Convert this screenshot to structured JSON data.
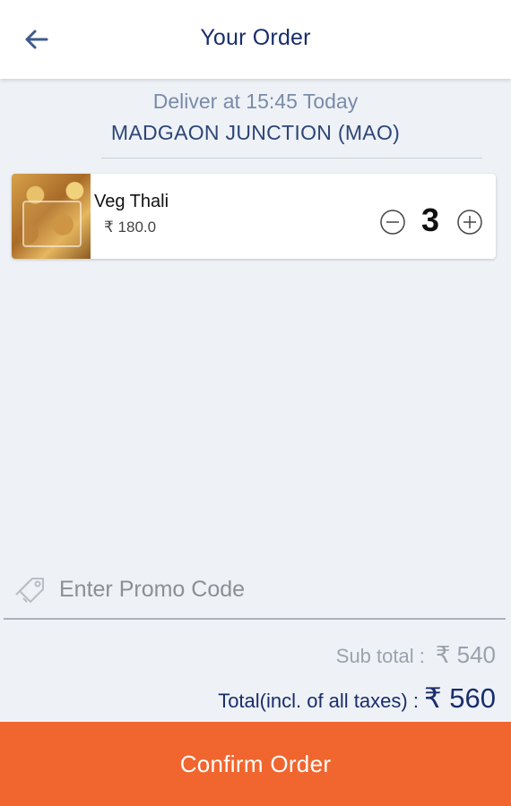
{
  "header": {
    "title": "Your Order",
    "back_icon": "arrow-left-icon"
  },
  "delivery": {
    "time_text": "Deliver at 15:45 Today",
    "station": "MADGAON JUNCTION (MAO)"
  },
  "items": [
    {
      "name": "Veg Thali",
      "price": "₹ 180.0",
      "quantity": "3",
      "decrement_icon": "minus-circle-icon",
      "increment_icon": "plus-circle-icon"
    }
  ],
  "promo": {
    "placeholder": "Enter Promo Code",
    "value": "",
    "icon": "tag-icon"
  },
  "totals": {
    "subtotal_label": "Sub total :",
    "subtotal_value": "₹ 540",
    "total_label": "Total(incl. of all taxes) :",
    "total_value": "₹ 560"
  },
  "confirm_label": "Confirm Order",
  "colors": {
    "accent": "#f0662e",
    "title": "#1a2d6b",
    "background": "#eef2f7"
  }
}
